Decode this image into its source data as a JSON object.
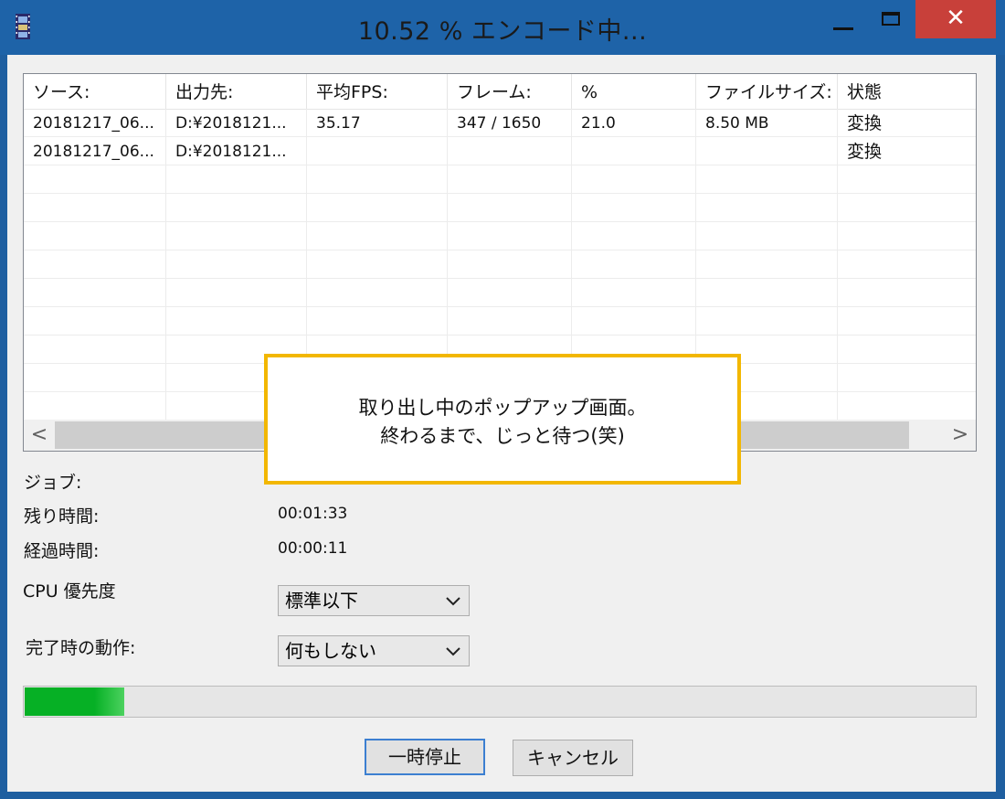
{
  "window": {
    "title": "10.52 % エンコード中...",
    "close_label": "✕"
  },
  "table": {
    "columns": [
      "ソース:",
      "出力先:",
      "平均FPS:",
      "フレーム:",
      "%",
      "ファイルサイズ:",
      "状態"
    ],
    "rows": [
      [
        "20181217_06...",
        "D:¥2018121...",
        "35.17",
        "347 / 1650",
        "21.0",
        "8.50 MB",
        "変換"
      ],
      [
        "20181217_06...",
        "D:¥2018121...",
        "",
        "",
        "",
        "",
        "変換"
      ]
    ],
    "scroll_left": "<",
    "scroll_right": ">"
  },
  "info": {
    "job_label": "ジョブ:",
    "remaining_label": "残り時間:",
    "remaining_value": "00:01:33",
    "elapsed_label": "経過時間:",
    "elapsed_value": "00:00:11",
    "cpu_label": "CPU 優先度",
    "cpu_value": "標準以下",
    "completion_label": "完了時の動作:",
    "completion_value": "何もしない"
  },
  "progress": {
    "percent": 10.52,
    "color": "#06b025"
  },
  "buttons": {
    "pause": "一時停止",
    "cancel": "キャンセル"
  },
  "callout": {
    "line1": "取り出し中のポップアップ画面。",
    "line2": "終わるまで、じっと待つ(笑)",
    "border_color": "#f2b700"
  }
}
